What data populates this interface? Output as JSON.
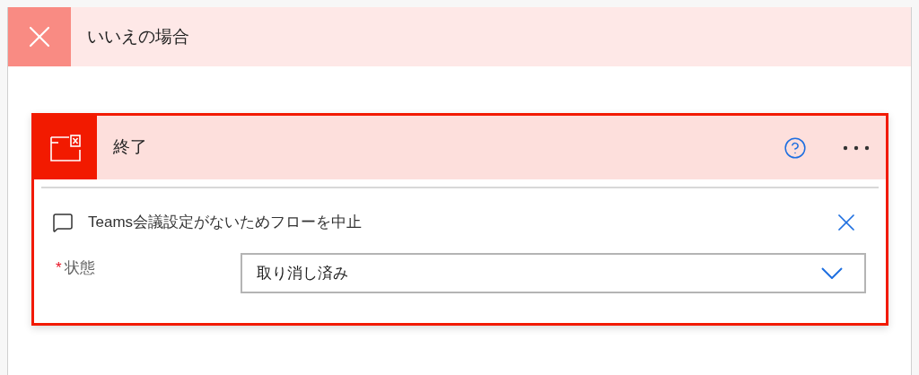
{
  "branch": {
    "title": "いいえの場合"
  },
  "action": {
    "title": "終了",
    "comment": "Teams会議設定がないためフローを中止",
    "field": {
      "required_mark": "*",
      "label": "状態",
      "value": "取り消し済み"
    }
  }
}
